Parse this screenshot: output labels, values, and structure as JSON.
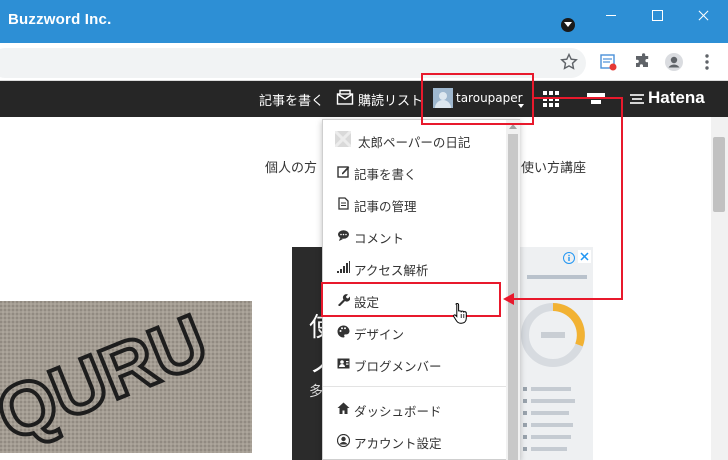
{
  "window": {
    "title": "Buzzword Inc.",
    "controls": [
      "minimize-icon",
      "maximize-icon",
      "close-icon"
    ]
  },
  "toolbar": {
    "icons": [
      "star-icon",
      "reading-list-icon",
      "extensions-icon",
      "profile-icon",
      "menu-icon"
    ]
  },
  "header": {
    "write_article": "記事を書く",
    "reading_list": "購読リスト",
    "username": "taroupaper",
    "logo": "Hatena"
  },
  "blog": {
    "text_left": "個人の方",
    "text_right": "使い方講座",
    "photo_text": "QURU",
    "ad_text_1": "使",
    "ad_text_2": "ノ",
    "ad_text_3": "多"
  },
  "menu": {
    "items": [
      {
        "label": "太郎ペーパーの日記",
        "icon": "blog-avatar-icon"
      },
      {
        "label": "記事を書く",
        "icon": "edit-icon"
      },
      {
        "label": "記事の管理",
        "icon": "document-icon"
      },
      {
        "label": "コメント",
        "icon": "comment-icon"
      },
      {
        "label": "アクセス解析",
        "icon": "chart-icon"
      },
      {
        "label": "設定",
        "icon": "wrench-icon"
      },
      {
        "label": "デザイン",
        "icon": "palette-icon"
      },
      {
        "label": "ブログメンバー",
        "icon": "members-icon"
      },
      {
        "label": "ダッシュボード",
        "icon": "home-icon"
      },
      {
        "label": "アカウント設定",
        "icon": "account-icon"
      }
    ]
  },
  "colors": {
    "titlebar": "#2d8fd5",
    "header": "#262626",
    "annotation": "#e8192c"
  }
}
